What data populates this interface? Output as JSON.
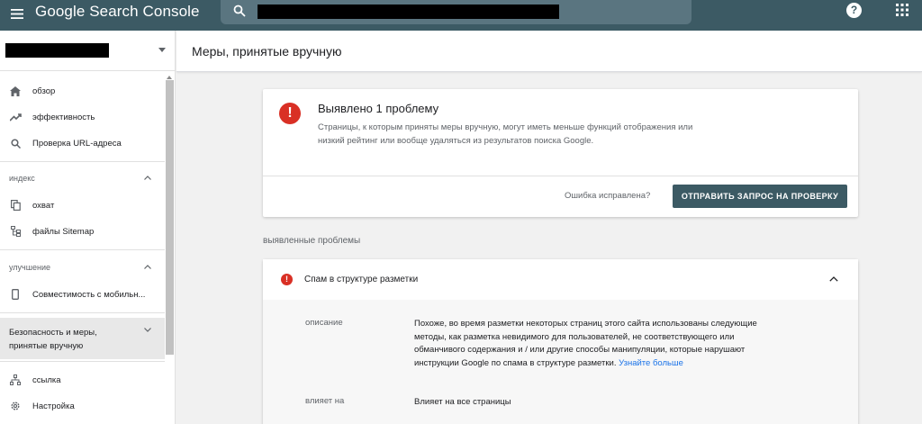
{
  "app": {
    "title": "Google Search Console"
  },
  "search": {
    "placeholder": "",
    "value": ""
  },
  "topbar_icons": [
    "menu-icon",
    "search-icon",
    "help-icon",
    "apps-icon"
  ],
  "sidebar": {
    "items_top": [
      {
        "label": "обзор",
        "icon": "home-icon"
      },
      {
        "label": "эффективность",
        "icon": "trending-up-icon"
      },
      {
        "label": "Проверка URL-адреса",
        "icon": "search-icon"
      }
    ],
    "sections": {
      "index": {
        "label": "индекс",
        "items": [
          {
            "label": "охват",
            "icon": "file-copy-icon"
          },
          {
            "label": "файлы Sitemap",
            "icon": "sitemap-icon"
          }
        ]
      },
      "enhancements": {
        "label": "улучшение",
        "items": [
          {
            "label": "Совместимость с мобильн...",
            "icon": "phone-icon"
          }
        ]
      },
      "security": {
        "label": "Безопасность и меры, принятые вручную",
        "line1": "Безопасность и меры,",
        "line2": "принятые вручную"
      }
    },
    "items_bottom": [
      {
        "label": "ссылка",
        "icon": "links-icon"
      },
      {
        "label": "Настройка",
        "icon": "settings-icon"
      }
    ]
  },
  "header": {
    "title": "Меры, принятые вручную"
  },
  "summary": {
    "title": "Выявлено 1 проблему",
    "description": "Страницы, к которым приняты меры вручную, могут иметь меньше функций отображения или низкий рейтинг или вообще удаляться из результатов поиска Google.",
    "fixed_question": "Ошибка исправлена?",
    "validate_button": "ОТПРАВИТЬ ЗАПРОС НА ПРОВЕРКУ"
  },
  "issues": {
    "caption": "выявленные проблемы",
    "item": {
      "name": "Спам в структуре разметки",
      "description_label": "описание",
      "description": "Похоже, во время разметки некоторых страниц этого сайта использованы следующие методы, как разметка невидимого для пользователей, не соответствующего или обманчивого содержания и / или другие способы манипуляции, которые нарушают инструкции Google по спама в структуре разметки.",
      "learn_more": "Узнайте больше",
      "affects_label": "влияет на",
      "affects": "Влияет на все страницы"
    }
  },
  "colors": {
    "topbar": "#3c5a64",
    "error": "#d93025",
    "link": "#1a73e8",
    "button": "#3c5a64"
  }
}
